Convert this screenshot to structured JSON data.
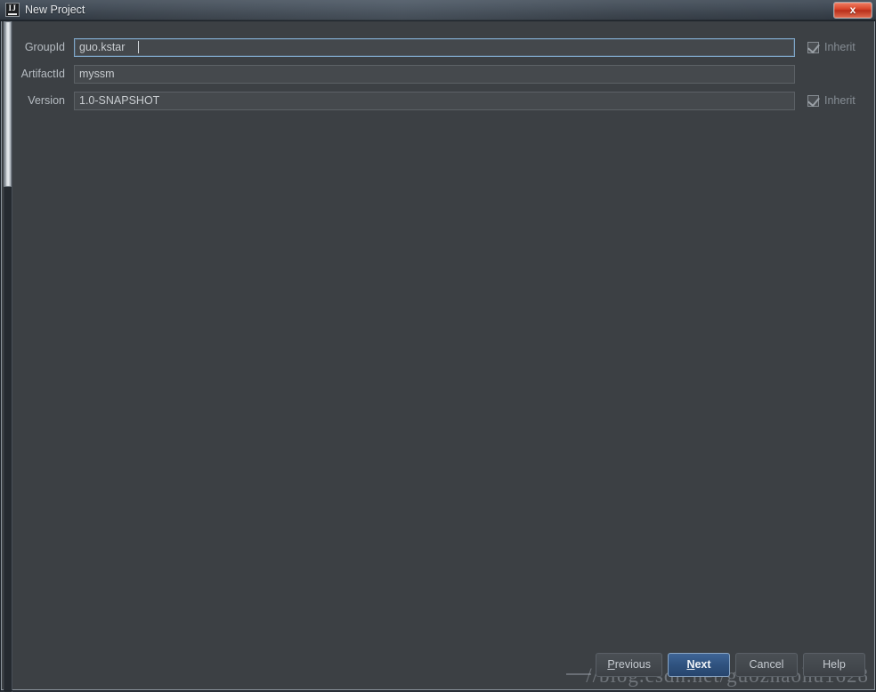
{
  "window": {
    "title": "New Project",
    "app_icon": "intellij-idea-icon",
    "icon_text": "IJ",
    "close_label": "x"
  },
  "form": {
    "rows": [
      {
        "label": "GroupId",
        "value": "guo.kstar",
        "focused": true,
        "inherit": {
          "label": "Inherit",
          "checked": true
        }
      },
      {
        "label": "ArtifactId",
        "value": "myssm",
        "focused": false,
        "inherit": null
      },
      {
        "label": "Version",
        "value": "1.0-SNAPSHOT",
        "focused": false,
        "inherit": {
          "label": "Inherit",
          "checked": true
        }
      }
    ]
  },
  "buttons": {
    "previous": {
      "prefix": "P",
      "rest": "revious"
    },
    "next": {
      "prefix": "N",
      "rest": "ext"
    },
    "cancel": "Cancel",
    "help": "Help"
  },
  "watermark": {
    "text": "//blog.csdn.net/guozhaohu1628"
  },
  "colors": {
    "dialog_background": "#3c4044",
    "input_background": "#45494d",
    "focus_border": "#7ea6c8",
    "primary_button": "#2f527f",
    "close_button": "#d9452a",
    "label_text": "#b6bcc2"
  }
}
